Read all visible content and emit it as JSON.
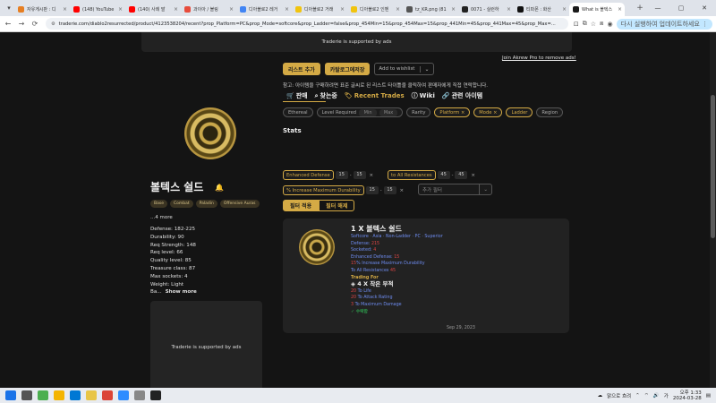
{
  "browser": {
    "tabs": [
      {
        "label": "자유게시판 : 디",
        "color": "#e67e22"
      },
      {
        "label": "(148) YouTube",
        "color": "#ff0000"
      },
      {
        "label": "(140) 사례 발",
        "color": "#ff0000"
      },
      {
        "label": "과이아 / 볼링",
        "color": "#e74c3c"
      },
      {
        "label": "디아블로2 레거",
        "color": "#4285f4"
      },
      {
        "label": "디아블로2 거래",
        "color": "#f1c40f"
      },
      {
        "label": "디아블로2 인벤",
        "color": "#f1c40f"
      },
      {
        "label": "tz_KR.png (81",
        "color": "#555555"
      },
      {
        "label": "0071 - 실런하",
        "color": "#222222"
      },
      {
        "label": "티파몬 : 화산",
        "color": "#111111"
      },
      {
        "label": "What is 볼텍스",
        "color": "#1a1a1a",
        "active": true
      }
    ],
    "new_tab": "+",
    "url": "traderie.com/diablo2resurrected/product/4123538204/recent?prop_Platform=PC&prop_Mode=softcore&prop_Ladder=false&prop_454Min=15&prop_454Max=15&prop_441Min=45&prop_441Max=45&prop_Max=...",
    "update_label": "다시 실행하여 업데이트하세요 ⋮"
  },
  "page": {
    "ad_top": "Traderie is supported by ads",
    "ad_side": "Traderie is supported by ads",
    "join_link": "Join Akrew Pro to remove ads!",
    "item": {
      "name": "볼텍스 쉴드",
      "tags": [
        "Base",
        "Combat",
        "Paladin",
        "Offensive Auras"
      ],
      "more": "...4 more",
      "props": [
        "Defense: 182-225",
        "Durability: 90",
        "Req Strength: 148",
        "Req level: 66",
        "Quality level: 85",
        "Treasure class: 87",
        "Max sockets: 4",
        "Weight: Light",
        "Ba..."
      ],
      "show_more": "Show more"
    },
    "buttons": {
      "list": "리스트 추가",
      "price_check": "카탈로그에저장",
      "wishlist": "Add to wishlist"
    },
    "note": "참고: 아이템을 구매하려면 표준 글씨로 된 리스트 타이틀을 클릭하여 판매자에게 직접 연락합니다.",
    "tabs": [
      {
        "label": "판매",
        "icon": "cart-icon"
      },
      {
        "label": "찾는중",
        "icon": "search-icon"
      },
      {
        "label": "Recent Trades",
        "icon": "tag-icon"
      },
      {
        "label": "Wiki",
        "icon": "info-icon"
      },
      {
        "label": "관련 아이템",
        "icon": "link-icon"
      }
    ],
    "filters": {
      "ethereal": "Ethereal",
      "level_req": "Level Required",
      "min": "Min",
      "max": "Max",
      "rarity": "Rarity",
      "platform": "Platform ×",
      "mode": "Mode ×",
      "ladder": "Ladder",
      "region": "Region"
    },
    "stats_label": "Stats",
    "stats": [
      {
        "name": "Enhanced Defense",
        "min": "15",
        "max": "15"
      },
      {
        "name": "to All Resistances",
        "min": "45",
        "max": "45"
      },
      {
        "name": "% Increase Maximum Durability",
        "min": "15",
        "max": "15"
      }
    ],
    "dash": "-",
    "remove": "×",
    "add_filter": "추가 필터",
    "toggle_on": "필터 적용",
    "toggle_off": "필터 해제",
    "listing": {
      "title": "1 X 볼텍스 쉴드",
      "meta": "Softcore · Asia · Non-Ladder · PC · Superior",
      "lines": [
        {
          "label": "Defense:",
          "value": "215"
        },
        {
          "label": "Socketed:",
          "value": "4"
        },
        {
          "label": "Enhanced Defense:",
          "value": "15"
        }
      ],
      "mods": [
        {
          "value": "15",
          "label": "% Increase Maximum Durability"
        },
        {
          "value": "45",
          "label": "To All Resistances"
        }
      ],
      "trading_for": "Trading For",
      "rune": "4 X 작은 부적",
      "rune_mods": [
        {
          "value": "20",
          "label": "To Life"
        },
        {
          "value": "20",
          "label": "To Attack Rating"
        },
        {
          "value": "3",
          "label": "To Maximum Damage"
        }
      ],
      "negotiable": "수락함",
      "date": "Sep 29, 2023"
    }
  },
  "taskbar": {
    "weather": "맑으로 흐려",
    "lang": "가",
    "time": "오후 1:33",
    "date": "2024-03-28"
  }
}
